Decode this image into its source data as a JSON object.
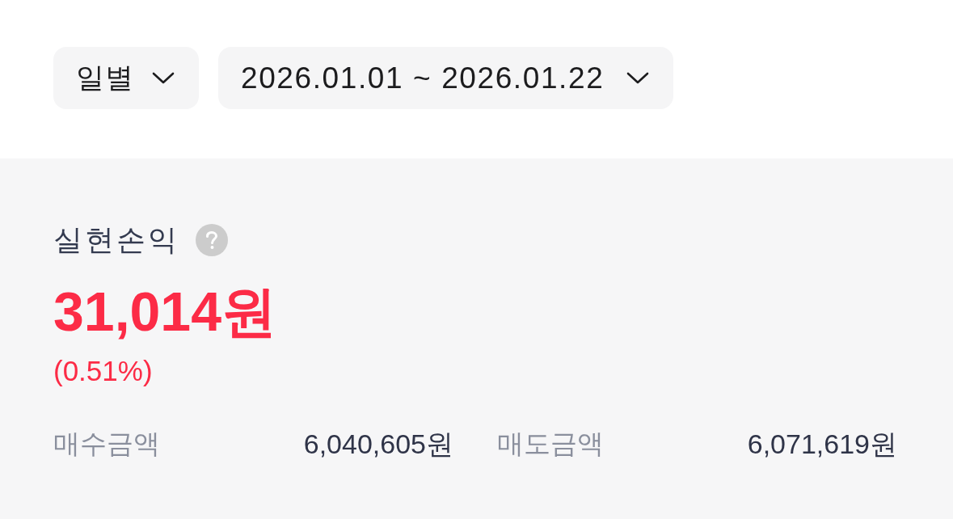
{
  "filters": [
    {
      "kind": "period",
      "value": "일별"
    },
    {
      "kind": "date_range",
      "value": "2026.01.01 ~ 2026.01.22"
    }
  ],
  "summary": {
    "title": "실현손익",
    "amount": "31,014원",
    "rate": "(0.51%)",
    "positive": true,
    "totals": [
      {
        "label": "매수금액",
        "value": "6,040,605원"
      },
      {
        "label": "매도금액",
        "value": "6,071,619원"
      }
    ]
  }
}
